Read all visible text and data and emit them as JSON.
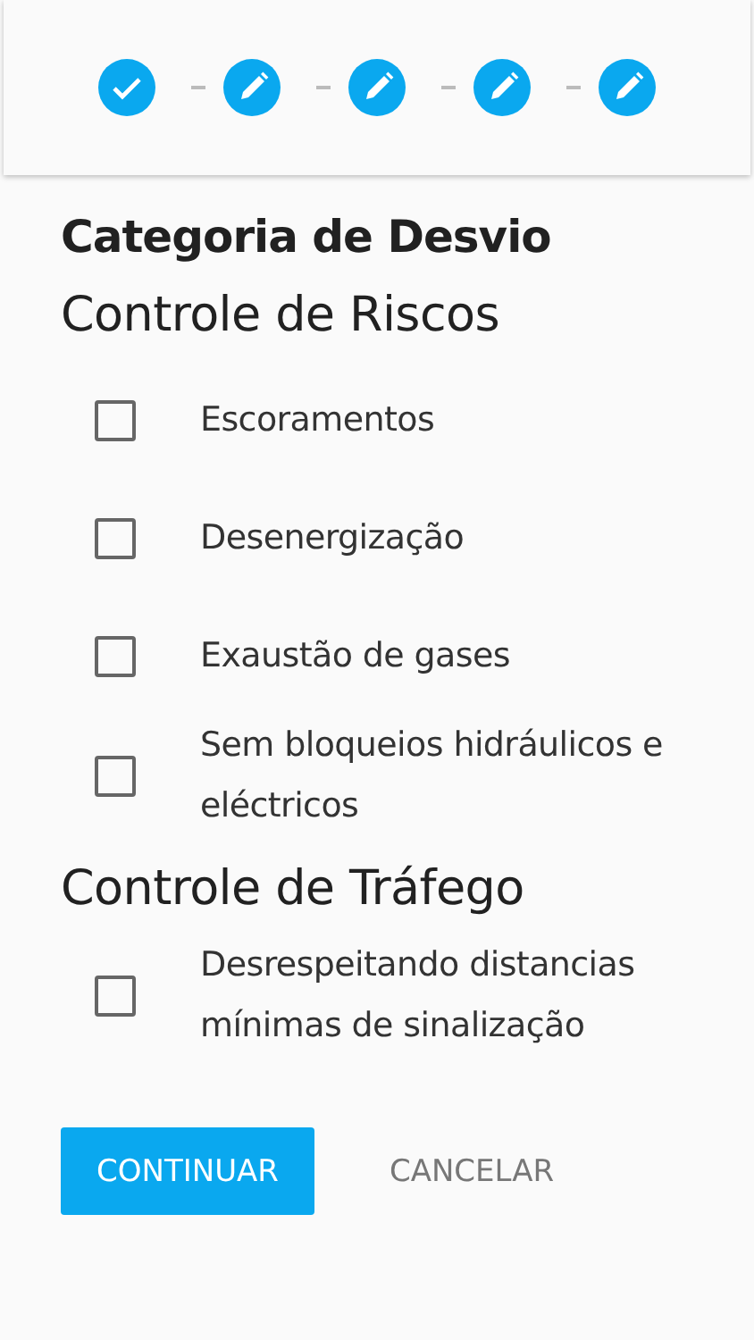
{
  "stepper": {
    "steps": [
      {
        "kind": "done"
      },
      {
        "kind": "edit"
      },
      {
        "kind": "edit"
      },
      {
        "kind": "edit"
      },
      {
        "kind": "edit"
      }
    ]
  },
  "title": "Categoria de Desvio",
  "sections": [
    {
      "heading": "Controle de Riscos",
      "options": [
        {
          "label": "Escoramentos",
          "checked": false
        },
        {
          "label": "Desenergização",
          "checked": false
        },
        {
          "label": "Exaustão de gases",
          "checked": false
        },
        {
          "label": "Sem bloqueios hidráulicos e eléctricos",
          "checked": false
        }
      ]
    },
    {
      "heading": "Controle de Tráfego",
      "options": [
        {
          "label": "Desrespeitando distancias mínimas de sinalização",
          "checked": false
        }
      ]
    }
  ],
  "buttons": [
    {
      "label": "CONTINUAR",
      "kind": "primary"
    },
    {
      "label": "CANCELAR",
      "kind": "text"
    }
  ]
}
